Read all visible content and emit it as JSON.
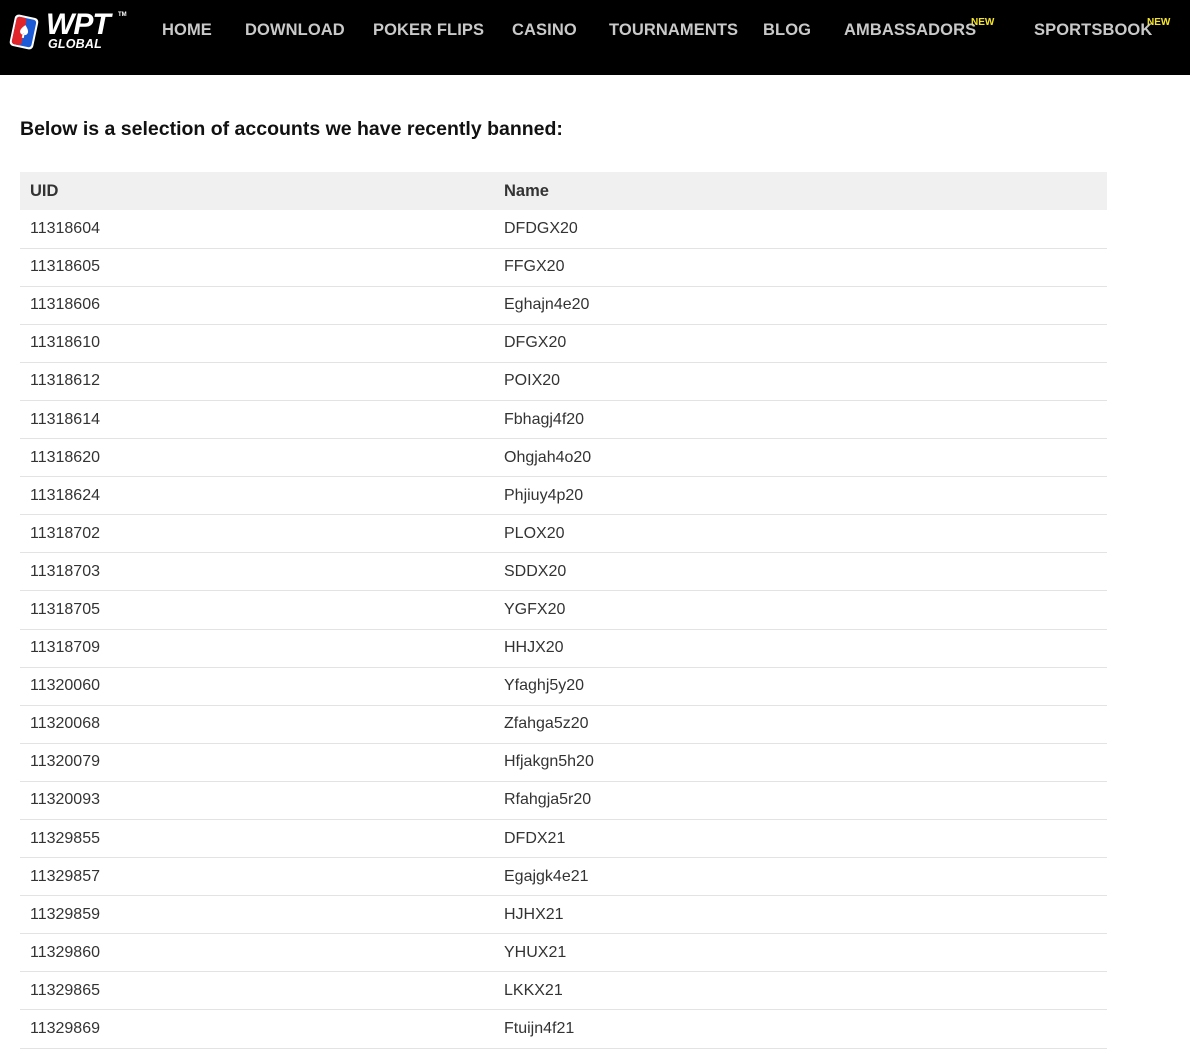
{
  "header": {
    "logo": {
      "brand": "WPT",
      "sub": "GLOBAL",
      "tm": "TM",
      "icon": "card-icon"
    },
    "nav": [
      {
        "label": "HOME",
        "badge": ""
      },
      {
        "label": "DOWNLOAD",
        "badge": ""
      },
      {
        "label": "POKER FLIPS",
        "badge": ""
      },
      {
        "label": "CASINO",
        "badge": ""
      },
      {
        "label": "TOURNAMENTS",
        "badge": ""
      },
      {
        "label": "BLOG",
        "badge": ""
      },
      {
        "label": "AMBASSADORS",
        "badge": "NEW"
      },
      {
        "label": "SPORTSBOOK",
        "badge": "NEW"
      }
    ],
    "colors": {
      "background": "#000000",
      "nav_text": "#c9c9c9",
      "badge": "#f5e52a"
    }
  },
  "main": {
    "intro": "Below is a selection of accounts we have recently banned:",
    "table": {
      "columns": [
        "UID",
        "Name"
      ],
      "rows": [
        [
          "11318604",
          "DFDGX20"
        ],
        [
          "11318605",
          "FFGX20"
        ],
        [
          "11318606",
          "Eghajn4e20"
        ],
        [
          "11318610",
          "DFGX20"
        ],
        [
          "11318612",
          "POIX20"
        ],
        [
          "11318614",
          "Fbhagj4f20"
        ],
        [
          "11318620",
          "Ohgjah4o20"
        ],
        [
          "11318624",
          "Phjiuy4p20"
        ],
        [
          "11318702",
          "PLOX20"
        ],
        [
          "11318703",
          "SDDX20"
        ],
        [
          "11318705",
          "YGFX20"
        ],
        [
          "11318709",
          "HHJX20"
        ],
        [
          "11320060",
          "Yfaghj5y20"
        ],
        [
          "11320068",
          "Zfahga5z20"
        ],
        [
          "11320079",
          "Hfjakgn5h20"
        ],
        [
          "11320093",
          "Rfahgja5r20"
        ],
        [
          "11329855",
          "DFDX21"
        ],
        [
          "11329857",
          "Egajgk4e21"
        ],
        [
          "11329859",
          "HJHX21"
        ],
        [
          "11329860",
          "YHUX21"
        ],
        [
          "11329865",
          "LKKX21"
        ],
        [
          "11329869",
          "Ftuijn4f21"
        ]
      ]
    }
  }
}
